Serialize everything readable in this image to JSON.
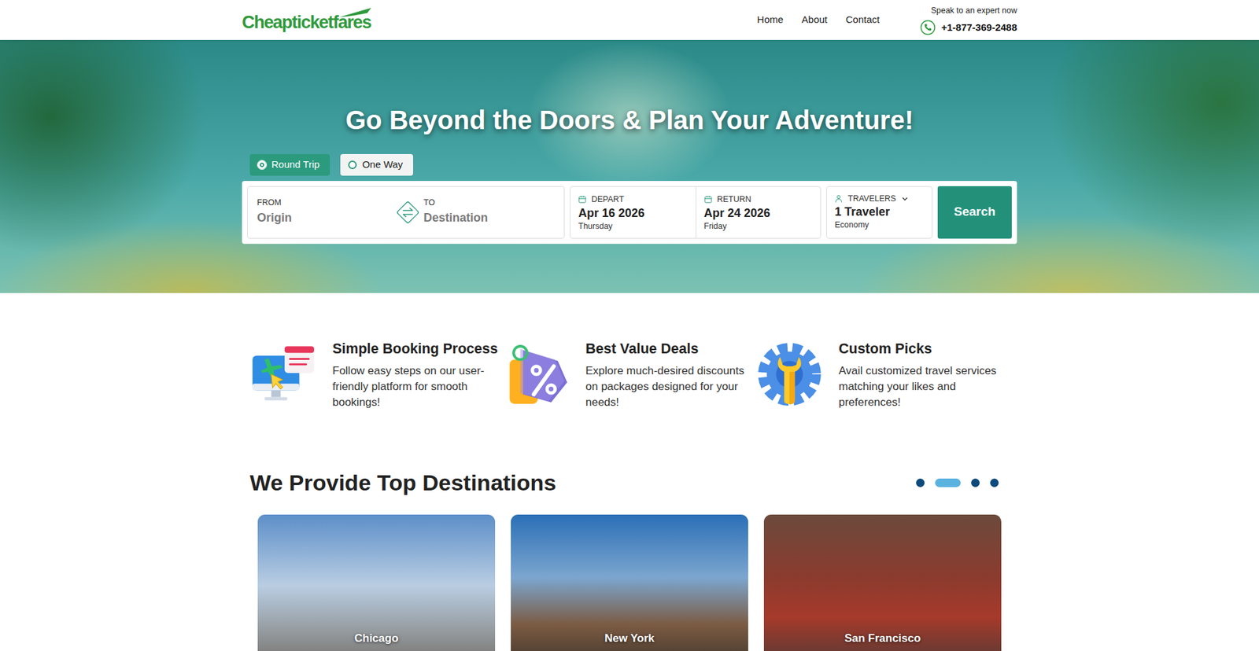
{
  "header": {
    "logo": "Cheapticketfares",
    "nav": [
      {
        "label": "Home"
      },
      {
        "label": "About"
      },
      {
        "label": "Contact"
      }
    ],
    "contact": {
      "caption": "Speak to an expert now",
      "phone": "+1-877-369-2488"
    }
  },
  "hero": {
    "title": "Go Beyond the Doors & Plan Your Adventure!",
    "trip_types": [
      {
        "label": "Round Trip",
        "selected": true
      },
      {
        "label": "One Way",
        "selected": false
      }
    ],
    "search": {
      "from": {
        "label": "FROM",
        "placeholder": "Origin"
      },
      "to": {
        "label": "TO",
        "placeholder": "Destination"
      },
      "depart": {
        "label": "DEPART",
        "date": "Apr 16 2026",
        "day": "Thursday"
      },
      "return": {
        "label": "RETURN",
        "date": "Apr 24 2026",
        "day": "Friday"
      },
      "travelers": {
        "label": "TRAVELERS",
        "value": "1 Traveler",
        "cabin": "Economy"
      },
      "button": "Search"
    }
  },
  "features": [
    {
      "title": "Simple Booking Process",
      "text": "Follow easy steps on our user-friendly platform for smooth bookings!"
    },
    {
      "title": "Best Value Deals",
      "text": "Explore much-desired discounts on packages designed for your needs!"
    },
    {
      "title": "Custom Picks",
      "text": "Avail customized travel services matching your likes and preferences!"
    }
  ],
  "destinations": {
    "title": "We Provide Top Destinations",
    "dots": [
      {
        "selected": false
      },
      {
        "selected": true
      },
      {
        "selected": false
      },
      {
        "selected": false
      }
    ],
    "cards": [
      {
        "name": "Chicago"
      },
      {
        "name": "New York"
      },
      {
        "name": "San Francisco"
      }
    ]
  }
}
